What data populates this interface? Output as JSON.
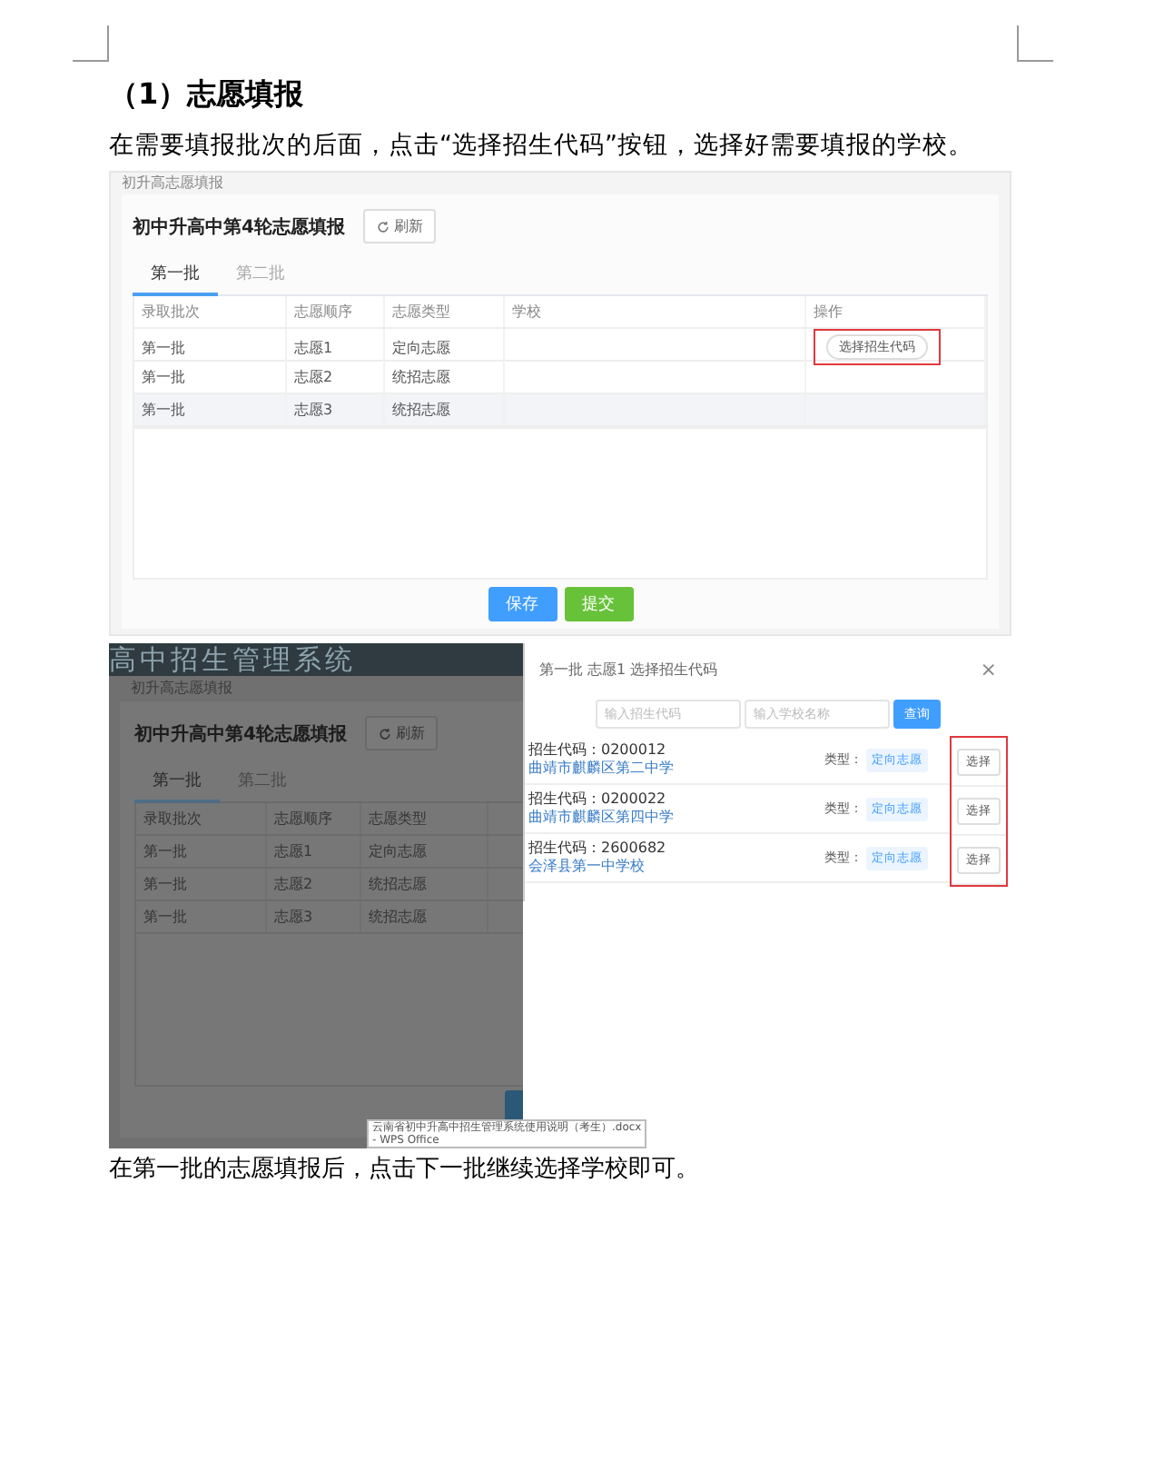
{
  "document": {
    "heading": "（1）志愿填报",
    "intro": "在需要填报批次的后面，点击“选择招生代码”按钮，选择好需要填报的学校。",
    "outro": "在第一批的志愿填报后，点击下一批继续选择学校即可。"
  },
  "screenshot_1": {
    "breadcrumb": "初升高志愿填报",
    "title": "初中升高中第4轮志愿填报",
    "refresh_button": "刷新",
    "tabs": [
      {
        "label": "第一批",
        "selected": true
      },
      {
        "label": "第二批",
        "selected": false
      }
    ],
    "columns": [
      "录取批次",
      "志愿顺序",
      "志愿类型",
      "学校",
      "操作"
    ],
    "rows": [
      {
        "cells": [
          "第一批",
          "志愿1",
          "定向志愿",
          ""
        ],
        "action": "选择招生代码",
        "marked": true,
        "hovered": false
      },
      {
        "cells": [
          "第一批",
          "志愿2",
          "统招志愿",
          ""
        ],
        "hovered": false
      },
      {
        "cells": [
          "第一批",
          "志愿3",
          "统招志愿",
          ""
        ],
        "hovered": true
      }
    ],
    "buttons": [
      {
        "label": "保存",
        "kind": "primary"
      },
      {
        "label": "提交",
        "kind": "success"
      }
    ]
  },
  "screenshot_2": {
    "banner": "高中招生管理系统",
    "breadcrumb": "初升高志愿填报",
    "title": "初中升高中第4轮志愿填报",
    "refresh_button": "刷新",
    "tabs": [
      {
        "label": "第一批",
        "selected": true
      },
      {
        "label": "第二批",
        "selected": false
      }
    ],
    "columns": [
      "录取批次",
      "志愿顺序",
      "志愿类型"
    ],
    "rows": [
      {
        "cells": [
          "第一批",
          "志愿1",
          "定向志愿"
        ]
      },
      {
        "cells": [
          "第一批",
          "志愿2",
          "统招志愿"
        ]
      },
      {
        "cells": [
          "第一批",
          "志愿3",
          "统招志愿"
        ]
      }
    ],
    "dialog": {
      "title": "第一批 志愿1 选择招生代码",
      "close": "×",
      "code_placeholder": "输入招生代码",
      "name_placeholder": "输入学校名称",
      "search_button": "查询",
      "select_marked": true,
      "schools": [
        {
          "code": "招生代码：0200012",
          "name": "曲靖市麒麟区第二中学",
          "type_label": "类型：",
          "type": "定向志愿",
          "select": "选择"
        },
        {
          "code": "招生代码：0200022",
          "name": "曲靖市麒麟区第四中学",
          "type_label": "类型：",
          "type": "定向志愿",
          "select": "选择"
        },
        {
          "code": "招生代码：2600682",
          "name": "会泽县第一中学校",
          "type_label": "类型：",
          "type": "定向志愿",
          "select": "选择"
        }
      ]
    },
    "tooltip": [
      "云南省初中升高中招生管理系统使用说明（考生）.docx",
      "- WPS Office"
    ]
  }
}
